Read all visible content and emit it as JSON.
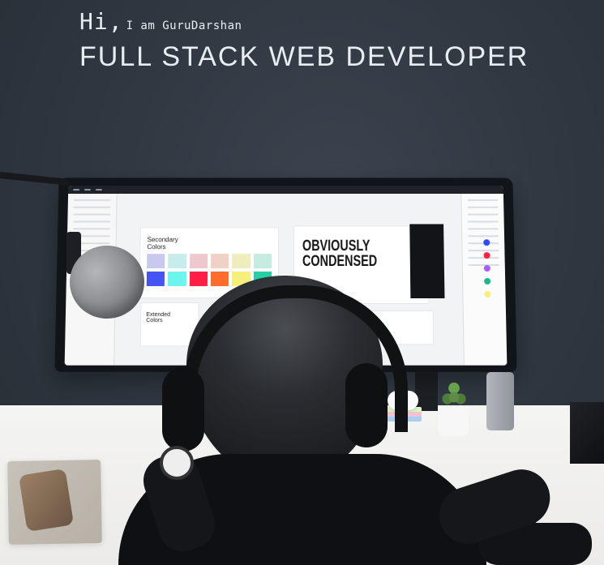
{
  "hero": {
    "greeting": "Hi,",
    "name_intro": "I am GuruDarshan",
    "title": "FULL STACK WEB DEVELOPER"
  },
  "screen": {
    "secondary_colors_label": "Secondary\nColors",
    "headline": "OBVIOUSLY\nCONDENSED",
    "extended_colors_label": "Extended\nColors"
  },
  "colors": {
    "background": "#2a3038",
    "text": "#e9edf2",
    "swatches": [
      "#c9c9f0",
      "#c8ecec",
      "#efc8cf",
      "#f0d1c6",
      "#ededbd",
      "#c6ebe0",
      "#4554f3",
      "#6af5f0",
      "#ff1f45",
      "#ff6d2d",
      "#f6f07a",
      "#25d0a5"
    ],
    "right_panel_dots": [
      "#2b49ff",
      "#ff1f45",
      "#aa5cff",
      "#19b98c",
      "#f6f07a"
    ]
  }
}
